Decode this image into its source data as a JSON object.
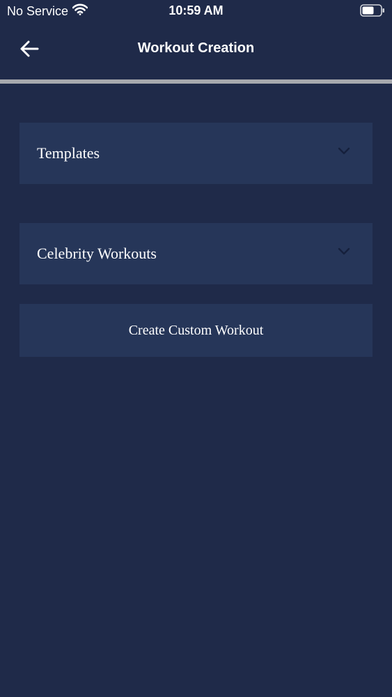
{
  "status_bar": {
    "carrier": "No Service",
    "time": "10:59 AM",
    "wifi_icon": "wifi-icon",
    "battery_icon": "battery-icon"
  },
  "nav": {
    "title": "Workout Creation",
    "back_icon": "arrow-left-icon"
  },
  "sections": [
    {
      "label": "Templates",
      "icon": "chevron-down-icon"
    },
    {
      "label": "Celebrity Workouts",
      "icon": "chevron-down-icon"
    }
  ],
  "actions": {
    "create_custom_label": "Create Custom Workout"
  },
  "colors": {
    "background": "#1f2a49",
    "card": "#263659",
    "divider": "#a7a9ae",
    "chevron": "#15203c"
  }
}
